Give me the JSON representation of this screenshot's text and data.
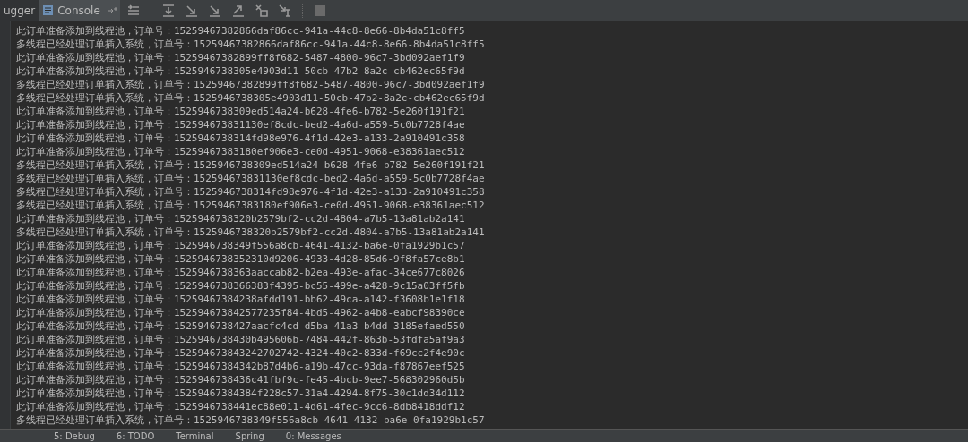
{
  "tabs": [
    {
      "label": "ugger",
      "selected": false
    },
    {
      "label": "Console",
      "selected": true
    }
  ],
  "console_lines": [
    "此订单准备添加到线程池，订单号：15259467382866daf86cc-941a-44c8-8e66-8b4da51c8ff5",
    "多线程已经处理订单插入系统，订单号：15259467382866daf86cc-941a-44c8-8e66-8b4da51c8ff5",
    "此订单准备添加到线程池，订单号：15259467382899ff8f682-5487-4800-96c7-3bd092aef1f9",
    "此订单准备添加到线程池，订单号：1525946738305e4903d11-50cb-47b2-8a2c-cb462ec65f9d",
    "多线程已经处理订单插入系统，订单号：15259467382899ff8f682-5487-4800-96c7-3bd092aef1f9",
    "多线程已经处理订单插入系统，订单号：1525946738305e4903d11-50cb-47b2-8a2c-cb462ec65f9d",
    "此订单准备添加到线程池，订单号：1525946738309ed514a24-b628-4fe6-b782-5e260f191f21",
    "此订单准备添加到线程池，订单号：152594673831130ef8cdc-bed2-4a6d-a559-5c0b7728f4ae",
    "此订单准备添加到线程池，订单号：1525946738314fd98e976-4f1d-42e3-a133-2a910491c358",
    "此订单准备添加到线程池，订单号：15259467383180ef906e3-ce0d-4951-9068-e38361aec512",
    "多线程已经处理订单插入系统，订单号：1525946738309ed514a24-b628-4fe6-b782-5e260f191f21",
    "多线程已经处理订单插入系统，订单号：152594673831130ef8cdc-bed2-4a6d-a559-5c0b7728f4ae",
    "多线程已经处理订单插入系统，订单号：1525946738314fd98e976-4f1d-42e3-a133-2a910491c358",
    "多线程已经处理订单插入系统，订单号：15259467383180ef906e3-ce0d-4951-9068-e38361aec512",
    "此订单准备添加到线程池，订单号：1525946738320b2579bf2-cc2d-4804-a7b5-13a81ab2a141",
    "多线程已经处理订单插入系统，订单号：1525946738320b2579bf2-cc2d-4804-a7b5-13a81ab2a141",
    "此订单准备添加到线程池，订单号：1525946738349f556a8cb-4641-4132-ba6e-0fa1929b1c57",
    "此订单准备添加到线程池，订单号：1525946738352310d9206-4933-4d28-85d6-9f8fa57ce8b1",
    "此订单准备添加到线程池，订单号：1525946738363aaccab82-b2ea-493e-afac-34ce677c8026",
    "此订单准备添加到线程池，订单号：1525946738366383f4395-bc55-499e-a428-9c15a03ff5fb",
    "此订单准备添加到线程池，订单号：15259467384238afdd191-bb62-49ca-a142-f3608b1e1f18",
    "此订单准备添加到线程池，订单号：152594673842577235f84-4bd5-4962-a4b8-eabcf98390ce",
    "此订单准备添加到线程池，订单号：1525946738427aacfc4cd-d5ba-41a3-b4dd-3185efaed550",
    "此订单准备添加到线程池，订单号：1525946738430b495606b-7484-442f-863b-53fdfa5af9a3",
    "此订单准备添加到线程池，订单号：152594673843242702742-4324-40c2-833d-f69cc2f4e90c",
    "此订单准备添加到线程池，订单号：15259467384342b87d4b6-a19b-47cc-93da-f87867eef525",
    "此订单准备添加到线程池，订单号：1525946738436c41fbf9c-fe45-4bcb-9ee7-568302960d5b",
    "此订单准备添加到线程池，订单号：15259467384384f228c57-31a4-4294-8f75-30c1dd34d112",
    "此订单准备添加到线程池，订单号：1525946738441ec88e011-4d61-4fec-9cc6-8db8418ddf12",
    "多线程已经处理订单插入系统，订单号：1525946738349f556a8cb-4641-4132-ba6e-0fa1929b1c57"
  ],
  "bottom_tabs": [
    "5: Debug",
    "6: TODO",
    "Terminal",
    "Spring",
    "0: Messages"
  ]
}
